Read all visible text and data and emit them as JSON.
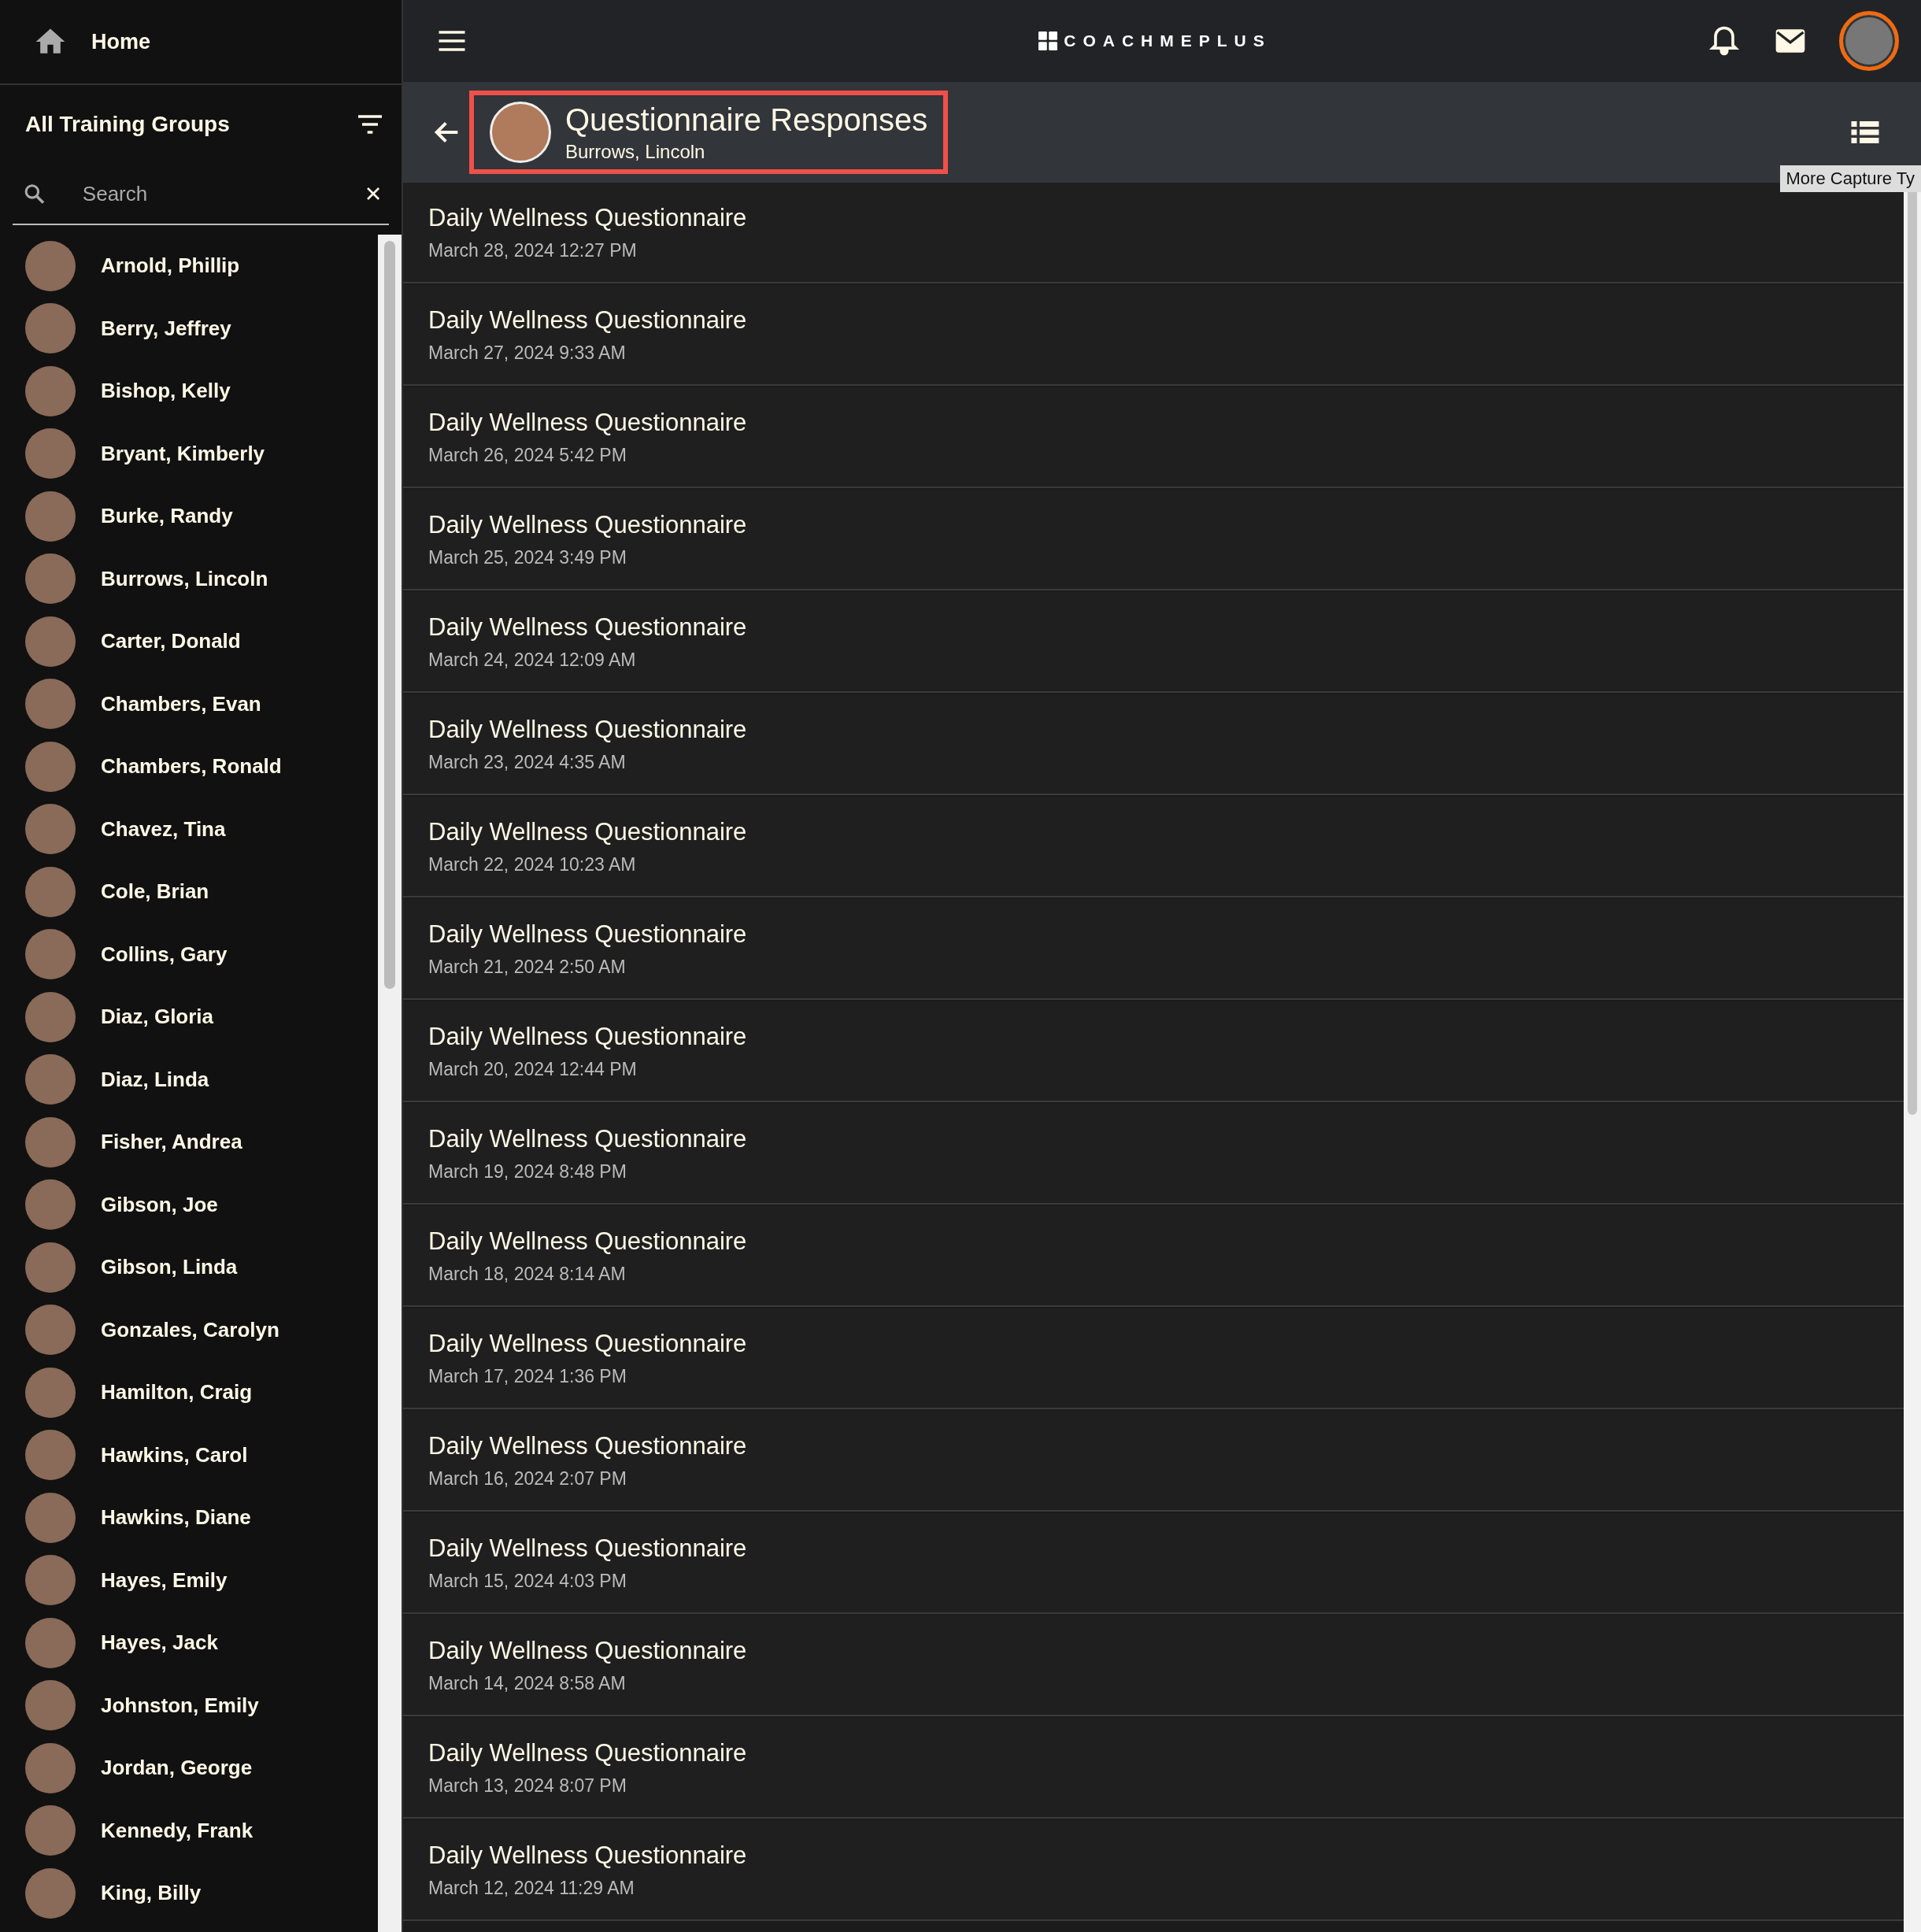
{
  "sidebar": {
    "home": "Home",
    "group_title": "All Training Groups",
    "search": {
      "placeholder": "Search"
    },
    "athletes": [
      "Arnold, Phillip",
      "Berry, Jeffrey",
      "Bishop, Kelly",
      "Bryant, Kimberly",
      "Burke, Randy",
      "Burrows, Lincoln",
      "Carter, Donald",
      "Chambers, Evan",
      "Chambers, Ronald",
      "Chavez, Tina",
      "Cole, Brian",
      "Collins, Gary",
      "Diaz, Gloria",
      "Diaz, Linda",
      "Fisher, Andrea",
      "Gibson, Joe",
      "Gibson, Linda",
      "Gonzales, Carolyn",
      "Hamilton, Craig",
      "Hawkins, Carol",
      "Hawkins, Diane",
      "Hayes, Emily",
      "Hayes, Jack",
      "Johnston, Emily",
      "Jordan, George",
      "Kennedy, Frank",
      "King, Billy"
    ]
  },
  "top_bar": {
    "logo": "COACHMEPLUS"
  },
  "header": {
    "title": "Questionnaire Responses",
    "subtitle": "Burrows, Lincoln",
    "tooltip": "More Capture Ty"
  },
  "responses": [
    {
      "title": "Daily Wellness Questionnaire",
      "date": "March 28, 2024 12:27 PM"
    },
    {
      "title": "Daily Wellness Questionnaire",
      "date": "March 27, 2024 9:33 AM"
    },
    {
      "title": "Daily Wellness Questionnaire",
      "date": "March 26, 2024 5:42 PM"
    },
    {
      "title": "Daily Wellness Questionnaire",
      "date": "March 25, 2024 3:49 PM"
    },
    {
      "title": "Daily Wellness Questionnaire",
      "date": "March 24, 2024 12:09 AM"
    },
    {
      "title": "Daily Wellness Questionnaire",
      "date": "March 23, 2024 4:35 AM"
    },
    {
      "title": "Daily Wellness Questionnaire",
      "date": "March 22, 2024 10:23 AM"
    },
    {
      "title": "Daily Wellness Questionnaire",
      "date": "March 21, 2024 2:50 AM"
    },
    {
      "title": "Daily Wellness Questionnaire",
      "date": "March 20, 2024 12:44 PM"
    },
    {
      "title": "Daily Wellness Questionnaire",
      "date": "March 19, 2024 8:48 PM"
    },
    {
      "title": "Daily Wellness Questionnaire",
      "date": "March 18, 2024 8:14 AM"
    },
    {
      "title": "Daily Wellness Questionnaire",
      "date": "March 17, 2024 1:36 PM"
    },
    {
      "title": "Daily Wellness Questionnaire",
      "date": "March 16, 2024 2:07 PM"
    },
    {
      "title": "Daily Wellness Questionnaire",
      "date": "March 15, 2024 4:03 PM"
    },
    {
      "title": "Daily Wellness Questionnaire",
      "date": "March 14, 2024 8:58 AM"
    },
    {
      "title": "Daily Wellness Questionnaire",
      "date": "March 13, 2024 8:07 PM"
    },
    {
      "title": "Daily Wellness Questionnaire",
      "date": "March 12, 2024 11:29 AM"
    }
  ]
}
